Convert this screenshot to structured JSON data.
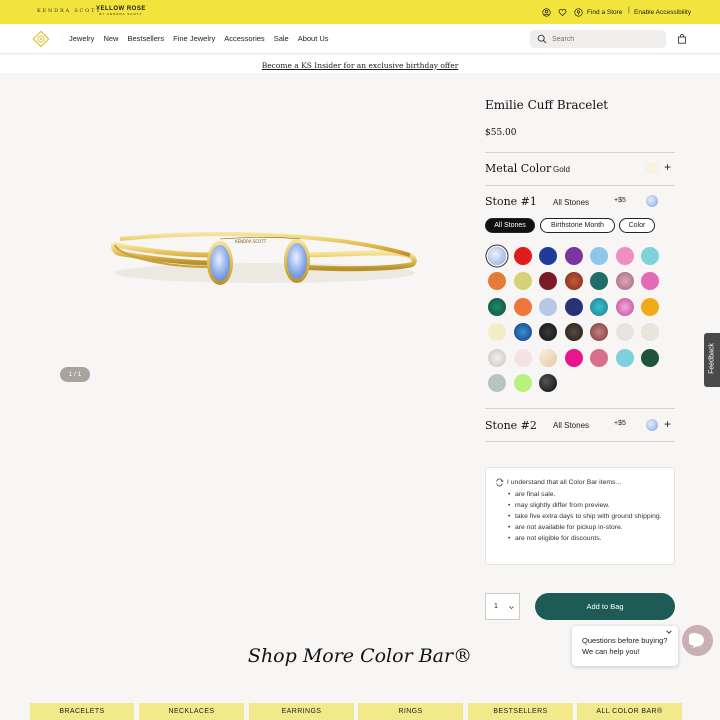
{
  "topbar": {
    "brand_left": "KENDRA SCOTT",
    "brand_right_main": "YELLOW ROSE",
    "brand_right_sub": "BY KENDRA SCOTT",
    "find_store": "Find a Store",
    "separator": "|",
    "accessibility": "Enable Accessibility"
  },
  "nav": {
    "items": [
      "Jewelry",
      "New",
      "Bestsellers",
      "Fine Jewelry",
      "Accessories",
      "Sale",
      "About Us"
    ]
  },
  "search": {
    "placeholder": "Search"
  },
  "promo": {
    "text": "Become a KS Insider for an exclusive birthday offer"
  },
  "gallery": {
    "pager": "1 / 1"
  },
  "product": {
    "title": "Emilie Cuff Bracelet",
    "price": "$55.00"
  },
  "metal": {
    "label": "Metal Color",
    "value": "Gold",
    "toggle": "+"
  },
  "stone1": {
    "label": "Stone #1",
    "value": "All Stones",
    "upcharge": "+$5",
    "filters": [
      "All Stones",
      "Birthstone Month",
      "Color"
    ],
    "active_filter": "All Stones",
    "selected_swatch": "light-blue-opal"
  },
  "stone2": {
    "label": "Stone #2",
    "value": "All Stones",
    "upcharge": "+$5",
    "toggle": "+"
  },
  "notice": {
    "heading": "I understand that all Color Bar items...",
    "items": [
      "are final sale.",
      "may slightly differ from preview.",
      "take five extra days to ship with ground shipping.",
      "are not available for pickup in-store.",
      "are not eligible for discounts."
    ]
  },
  "purchase": {
    "quantity": "1",
    "add_to_bag": "Add to Bag"
  },
  "chat": {
    "line1": "Questions before buying?",
    "line2": "We can help you!"
  },
  "feedback": {
    "label": "Feedback"
  },
  "more": {
    "title": "Shop More Color Bar®"
  },
  "categories": [
    "BRACELETS",
    "NECKLACES",
    "EARRINGS",
    "RINGS",
    "BESTSELLERS",
    "ALL COLOR BAR®"
  ],
  "colors": {
    "topbar": "#f2e43c",
    "accent_green": "#1e5b56",
    "category_tab": "#f2e98a",
    "gold": "#e6c24c"
  }
}
